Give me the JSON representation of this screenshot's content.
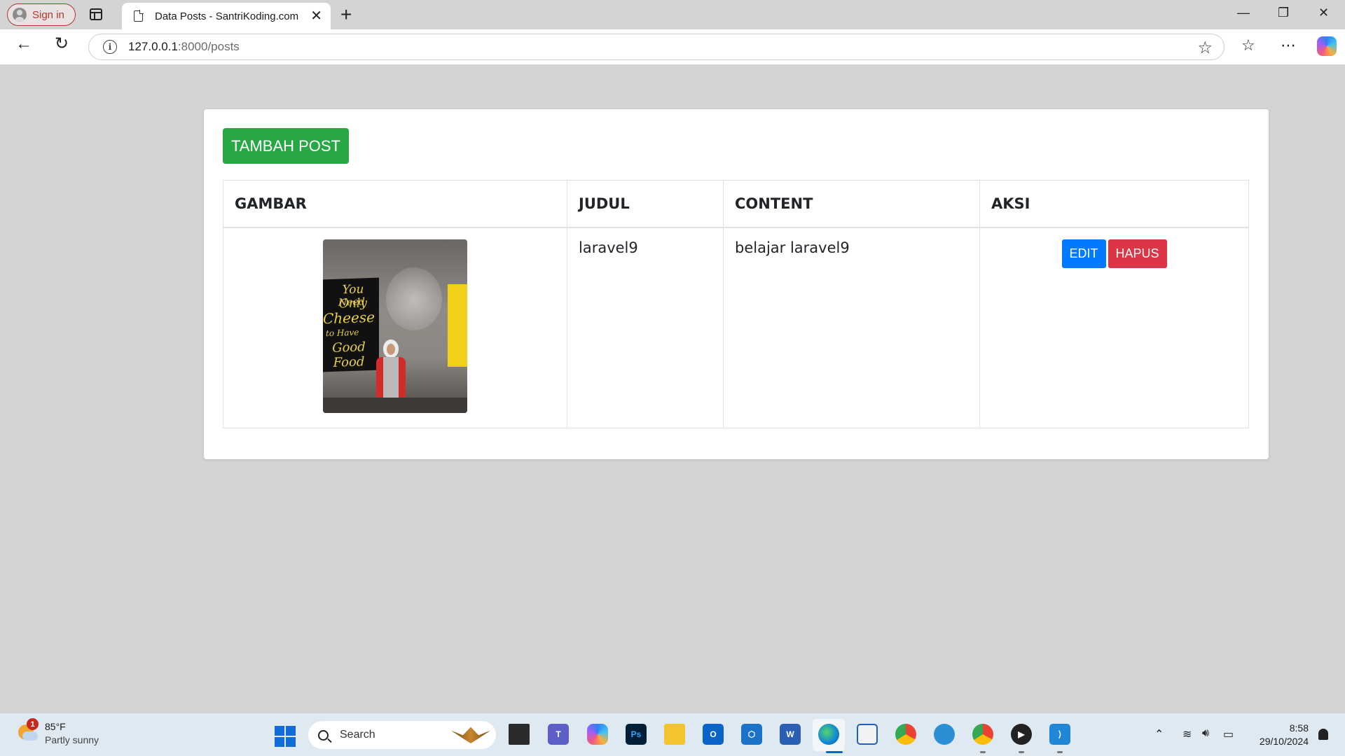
{
  "browser": {
    "signin_label": "Sign in",
    "tab_title": "Data Posts - SantriKoding.com",
    "tab_close": "✕",
    "new_tab": "+",
    "url_host": "127.0.0.1",
    "url_rest": ":8000/posts",
    "window_controls": {
      "minimize": "—",
      "restore": "❐",
      "close": "✕"
    }
  },
  "page": {
    "add_button": "TAMBAH POST",
    "columns": [
      "GAMBAR",
      "JUDUL",
      "CONTENT",
      "AKSI"
    ],
    "rows": [
      {
        "judul": "laravel9",
        "content": "belajar laravel9",
        "edit": "EDIT",
        "hapus": "HAPUS"
      }
    ],
    "thumb_text": [
      "You Only",
      "Need",
      "Cheese",
      "to Have",
      "Good Food"
    ]
  },
  "taskbar": {
    "temperature": "85°F",
    "condition": "Partly sunny",
    "weather_badge": "1",
    "search_label": "Search",
    "time": "8:58",
    "date": "29/10/2024"
  },
  "colors": {
    "success": "#28a745",
    "primary": "#007bff",
    "danger": "#dc3545",
    "page_bg": "#d4d4d4"
  }
}
